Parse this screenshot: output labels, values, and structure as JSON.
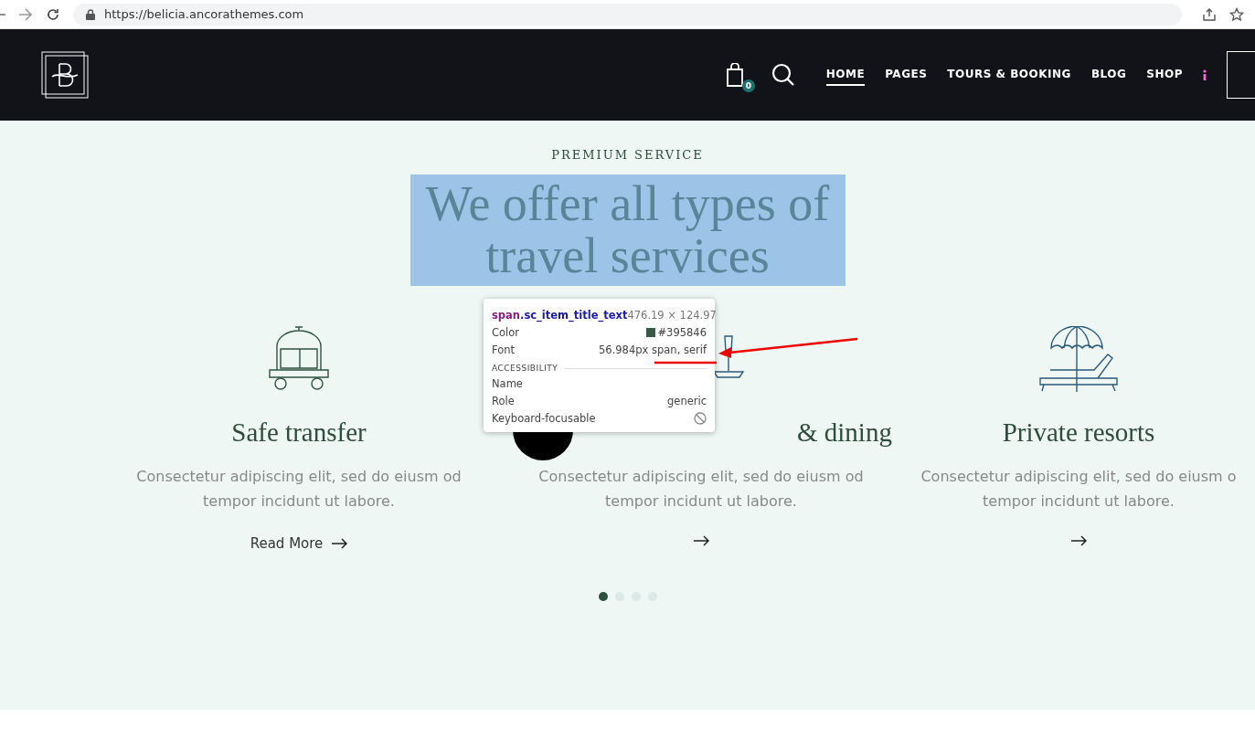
{
  "browser": {
    "url": "https://belicia.ancorathemes.com"
  },
  "header": {
    "cart_count": "0",
    "nav": [
      {
        "label": "HOME",
        "selected": true
      },
      {
        "label": "PAGES",
        "selected": false
      },
      {
        "label": "TOURS & BOOKING",
        "selected": false
      },
      {
        "label": "BLOG",
        "selected": false
      },
      {
        "label": "SHOP",
        "selected": false
      }
    ]
  },
  "hero": {
    "subtitle": "PREMIUM SERVICE",
    "title": "We offer all types of travel services",
    "title_selected": true,
    "cards": [
      {
        "title": "Safe transfer",
        "text": "Consectetur adipiscing elit, sed do eiusm od tempor incidunt ut labore.",
        "link": "Read More"
      },
      {
        "title": "& dining",
        "text": "Consectetur adipiscing elit, sed do eiusm od tempor incidunt ut labore."
      },
      {
        "title": "Private resorts",
        "text": "Consectetur adipiscing elit, sed do eiusm o tempor incidunt ut labore."
      }
    ],
    "dots": [
      {
        "selected": true
      },
      {
        "selected": false
      },
      {
        "selected": false
      },
      {
        "selected": false
      }
    ]
  },
  "tooltip": {
    "selector_tag": "span",
    "selector_class": ".sc_item_title_text",
    "size": "476.19 × 124.97",
    "color_label": "Color",
    "color": "#395846",
    "color_value": "#395846",
    "font_label": "Font",
    "font_value": "56.984px span, serif",
    "section": "ACCESSIBILITY",
    "rows": [
      {
        "label": "Name"
      },
      {
        "label": "Role",
        "value": "generic"
      },
      {
        "label": "Keyboard-focusable"
      }
    ]
  }
}
